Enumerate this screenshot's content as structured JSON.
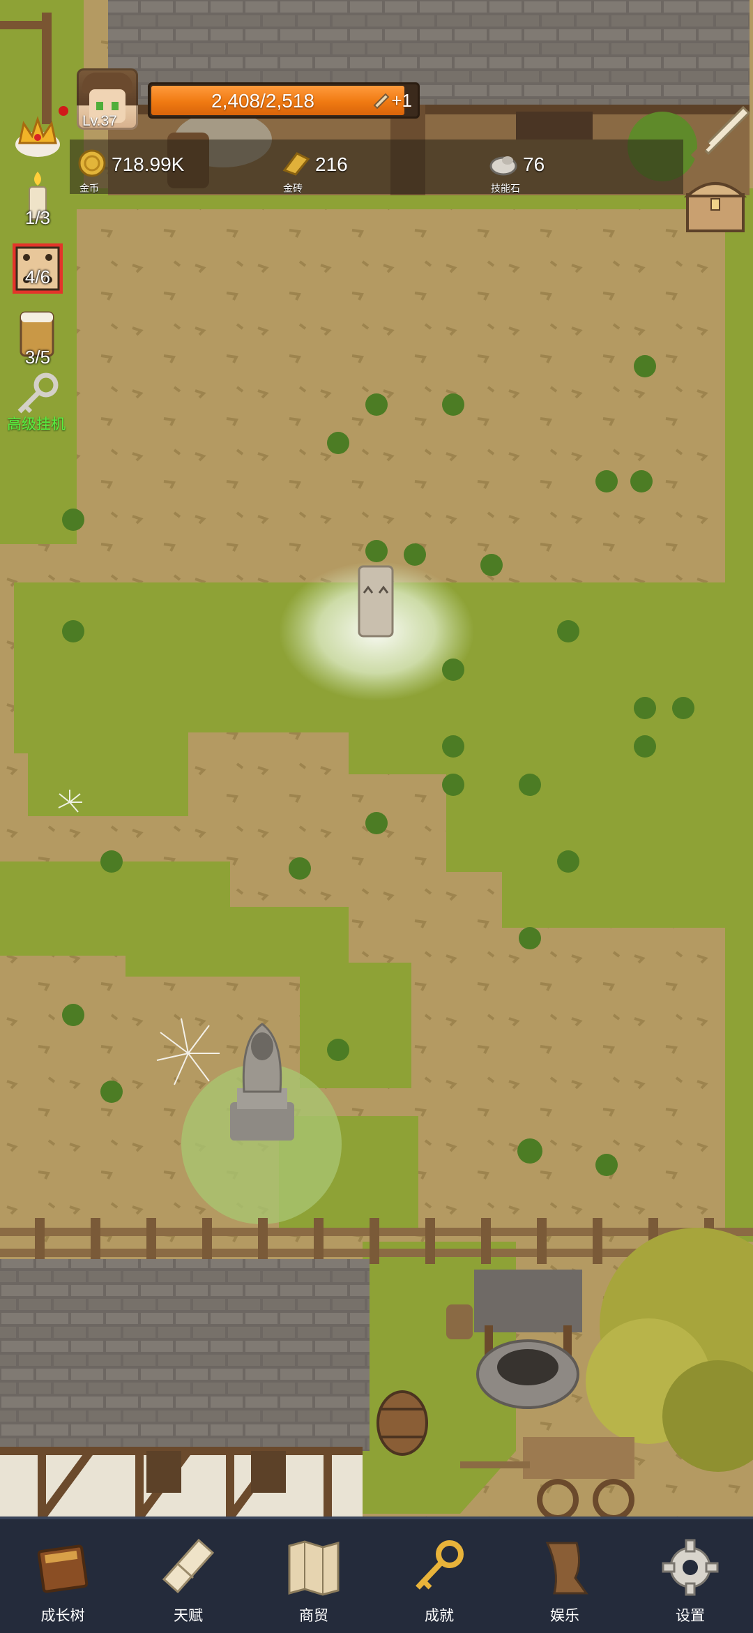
{
  "player": {
    "level": "Lv.37"
  },
  "xp": {
    "text": "2,408/2,518",
    "bonus": "+1",
    "progress": 0.956
  },
  "resources": [
    {
      "name": "gold",
      "value": "718.99K",
      "label": "金币",
      "icon": "gold-coin-icon"
    },
    {
      "name": "gold-brick",
      "value": "216",
      "label": "金砖",
      "icon": "gold-brick-icon"
    },
    {
      "name": "skill-stone",
      "value": "76",
      "label": "技能石",
      "icon": "skill-stone-icon"
    }
  ],
  "left_panel": {
    "crown": {
      "icon": "crown-icon"
    },
    "candle": {
      "count": "1/3",
      "icon": "candle-icon"
    },
    "dice": {
      "count": "4/6",
      "icon": "dice-icon"
    },
    "beer": {
      "count": "3/5",
      "icon": "beer-mug-icon"
    },
    "idle": {
      "label": "高级挂机",
      "icon": "key-icon"
    }
  },
  "right_panel": {
    "sword": {
      "icon": "sword-icon"
    },
    "chest": {
      "icon": "treasure-chest-icon"
    }
  },
  "nav": [
    {
      "label": "成长树",
      "icon": "book-icon"
    },
    {
      "label": "天赋",
      "icon": "scroll-icon"
    },
    {
      "label": "商贸",
      "icon": "map-icon"
    },
    {
      "label": "成就",
      "icon": "key-icon"
    },
    {
      "label": "娱乐",
      "icon": "parchment-icon"
    },
    {
      "label": "设置",
      "icon": "gear-icon"
    }
  ],
  "colors": {
    "nav_bg": "#242b3b",
    "xp_fill": "#f07a12",
    "idle_text": "#58f040",
    "grass": "#8ea236",
    "dirt": "#b49a62"
  }
}
